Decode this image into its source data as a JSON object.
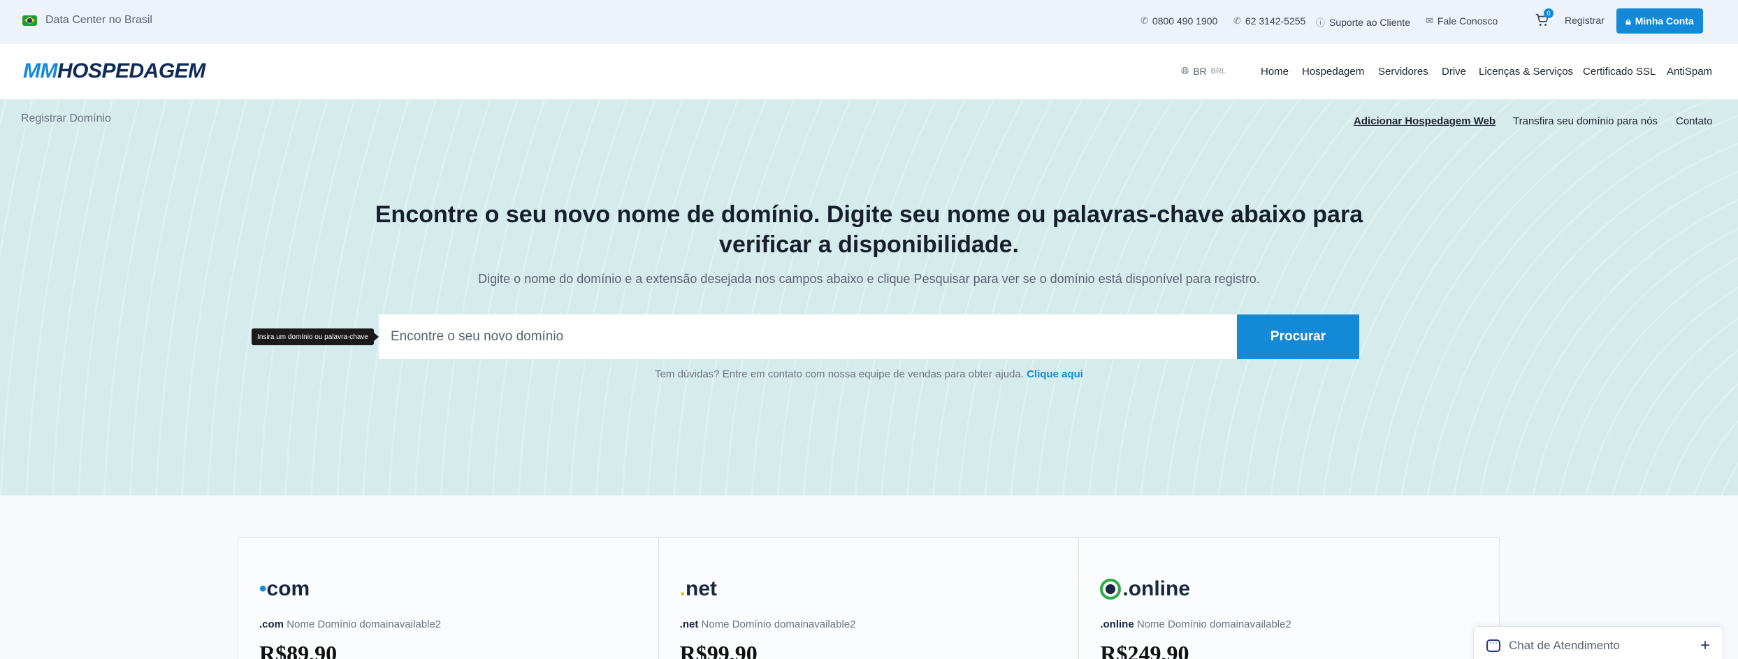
{
  "topbar": {
    "datacenter": "Data Center no Brasil",
    "phone1": "0800 490 1900",
    "phone2": "62 3142-5255",
    "support": "Suporte ao Cliente",
    "contact": "Fale Conosco",
    "cart_count": "0",
    "register": "Registrar",
    "account": "Minha Conta"
  },
  "header": {
    "logo_mm": "MM",
    "logo_host": "HOSPEDAGEM",
    "lang": "BR",
    "currency": "BRL",
    "nav": [
      "Home",
      "Hospedagem",
      "Servidores",
      "Drive",
      "Licenças & Serviços",
      "Certificado SSL",
      "AntiSpam"
    ]
  },
  "hero": {
    "breadcrumb": "Registrar Domínio",
    "subnav": [
      "Adicionar Hospedagem Web",
      "Transfira seu domínio para nós",
      "Contato"
    ],
    "title": "Encontre o seu novo nome de domínio. Digite seu nome ou palavras-chave abaixo para verificar a disponibilidade.",
    "subtitle": "Digite o nome do domínio e a extensão desejada nos campos abaixo e clique Pesquisar para ver se o domínio está disponível para registro.",
    "search_placeholder": "Encontre o seu novo domínio",
    "search_button": "Procurar",
    "tooltip": "Insira um domínio ou palavra-chave",
    "help_text": "Tem dúvidas? Entre em contato com nossa equipe de vendas para obter ajuda.",
    "help_link": "Clique aqui"
  },
  "cards": [
    {
      "logo_dot": "•",
      "logo_text": "com",
      "tld": ".com",
      "desc": "Nome Domínio domainavailable2",
      "price": "R$89,90"
    },
    {
      "logo_dot": ".",
      "logo_text": "net",
      "tld": ".net",
      "desc": "Nome Domínio domainavailable2",
      "price": "R$99,90"
    },
    {
      "logo_dot": ".",
      "logo_text": "online",
      "tld": ".online",
      "desc": "Nome Domínio domainavailable2",
      "price": "R$249,90"
    }
  ],
  "chat": {
    "label": "Chat de Atendimento",
    "plus": "+"
  }
}
